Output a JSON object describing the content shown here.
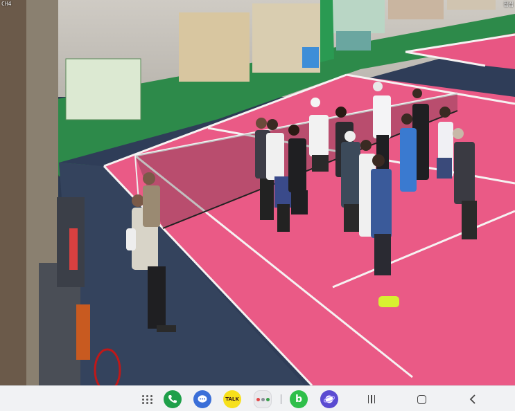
{
  "camera": {
    "channel_label": "CH4",
    "corner_text": "점심"
  },
  "scene": {
    "description_icon": "indoor-tennis-court-cctv-feed",
    "colors": {
      "court": "#ea5a86",
      "surround": "#2f3d58",
      "wall": "#2d8a4a",
      "lines": "#f6f2f2"
    }
  },
  "taskbar": {
    "apps": [
      {
        "id": "apps-grid",
        "icon": "apps-grid-icon"
      },
      {
        "id": "phone",
        "icon": "phone-icon"
      },
      {
        "id": "messages",
        "icon": "messages-icon"
      },
      {
        "id": "kakaotalk",
        "icon": "kakaotalk-icon",
        "text": "TALK"
      },
      {
        "id": "folder",
        "icon": "app-folder-icon"
      },
      {
        "id": "band",
        "icon": "b-app-icon",
        "text": "b"
      },
      {
        "id": "internet",
        "icon": "internet-browser-icon"
      }
    ],
    "nav": {
      "recents": "recents-icon",
      "home": "home-icon",
      "back": "back-icon"
    }
  }
}
